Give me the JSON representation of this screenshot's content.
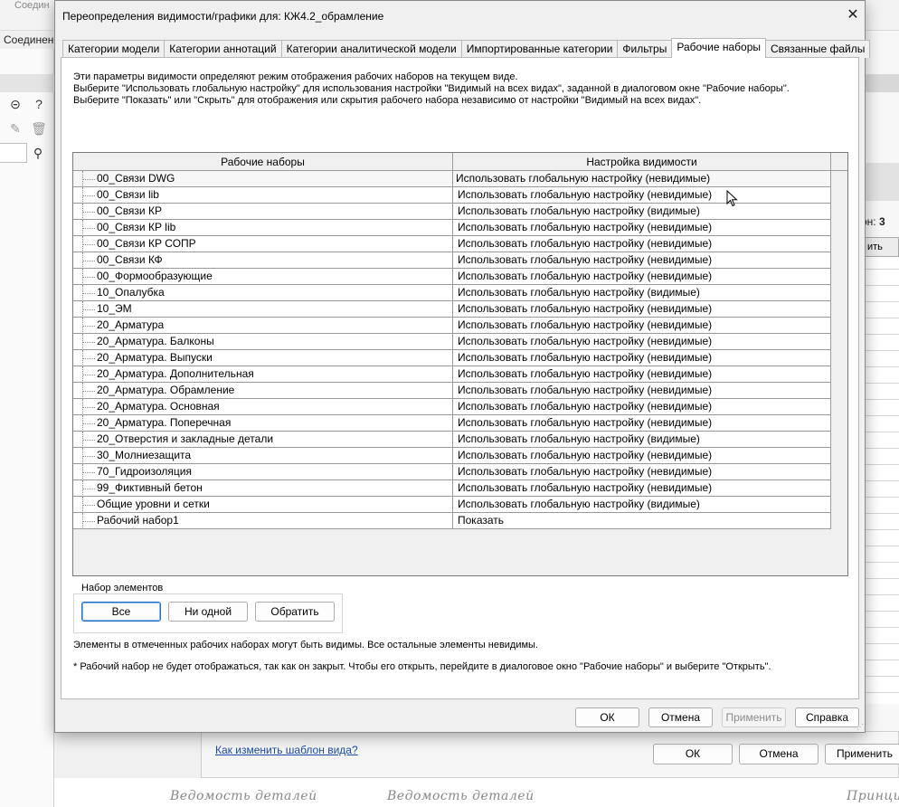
{
  "background": {
    "top_texts": [
      "Соедин",
      "Соединен"
    ],
    "left_label": "Соединени",
    "right_label_prefix": "он:",
    "right_label_value": "3",
    "right_cell": "ить",
    "lower_link": "Как изменить шаблон вида?",
    "lower_ok": "ОК",
    "lower_cancel": "Отмена",
    "lower_apply": "Применить",
    "bottom_texts": [
      "Ведомость деталей",
      "Ведомость деталей",
      "Принцип"
    ]
  },
  "dialog": {
    "title": "Переопределения видимости/графики для: КЖ4.2_обрамление",
    "close_icon": "close-icon",
    "tabs": [
      {
        "label": "Категории модели",
        "active": false
      },
      {
        "label": "Категории аннотаций",
        "active": false
      },
      {
        "label": "Категории аналитической модели",
        "active": false
      },
      {
        "label": "Импортированные категории",
        "active": false
      },
      {
        "label": "Фильтры",
        "active": false
      },
      {
        "label": "Рабочие наборы",
        "active": true
      },
      {
        "label": "Связанные файлы",
        "active": false
      }
    ],
    "description": [
      "Эти параметры видимости определяют режим отображения рабочих наборов на текущем виде.",
      "Выберите \"Использовать глобальную настройку\" для использования настройки \"Видимый на всех видах\", заданной в диалоговом окне \"Рабочие наборы\".",
      "Выберите \"Показать\" или \"Скрыть\" для отображения или скрытия рабочего набора независимо от настройки \"Видимый на всех видах\"."
    ],
    "table": {
      "columns": [
        "Рабочие наборы",
        "Настройка видимости"
      ],
      "rows": [
        [
          "00_Связи DWG",
          "Использовать глобальную настройку (невидимые)"
        ],
        [
          "00_Связи lib",
          "Использовать глобальную настройку (невидимые)"
        ],
        [
          "00_Связи КР",
          "Использовать глобальную настройку (видимые)"
        ],
        [
          "00_Связи КР lib",
          "Использовать глобальную настройку (невидимые)"
        ],
        [
          "00_Связи КР СОПР",
          "Использовать глобальную настройку (невидимые)"
        ],
        [
          "00_Связи КФ",
          "Использовать глобальную настройку (невидимые)"
        ],
        [
          "00_Формообразующие",
          "Использовать глобальную настройку (невидимые)"
        ],
        [
          "10_Опалубка",
          "Использовать глобальную настройку (видимые)"
        ],
        [
          "10_ЭМ",
          "Использовать глобальную настройку (невидимые)"
        ],
        [
          "20_Арматура",
          "Использовать глобальную настройку (невидимые)"
        ],
        [
          "20_Арматура. Балконы",
          "Использовать глобальную настройку (невидимые)"
        ],
        [
          "20_Арматура. Выпуски",
          "Использовать глобальную настройку (невидимые)"
        ],
        [
          "20_Арматура. Дополнительная",
          "Использовать глобальную настройку (невидимые)"
        ],
        [
          "20_Арматура. Обрамление",
          "Использовать глобальную настройку (невидимые)"
        ],
        [
          "20_Арматура. Основная",
          "Использовать глобальную настройку (невидимые)"
        ],
        [
          "20_Арматура. Поперечная",
          "Использовать глобальную настройку (невидимые)"
        ],
        [
          "20_Отверстия и закладные детали",
          "Использовать глобальную настройку (видимые)"
        ],
        [
          "30_Молниезащита",
          "Использовать глобальную настройку (невидимые)"
        ],
        [
          "70_Гидроизоляция",
          "Использовать глобальную настройку (невидимые)"
        ],
        [
          "99_Фиктивный бетон",
          "Использовать глобальную настройку (невидимые)"
        ],
        [
          "Общие уровни и сетки",
          "Использовать глобальную настройку (видимые)"
        ],
        [
          "Рабочий набор1",
          "Показать"
        ]
      ]
    },
    "selection_group": {
      "legend": "Набор элементов",
      "all": "Все",
      "none": "Ни одной",
      "invert": "Обратить"
    },
    "note1": "Элементы в отмеченных рабочих наборах могут быть видимы.  Все остальные элементы невидимы.",
    "note2": "* Рабочий набор не будет отображаться, так как он закрыт. Чтобы его открыть, перейдите в диалоговое окно \"Рабочие наборы\" и выберите \"Открыть\".",
    "buttons": {
      "ok": "ОК",
      "cancel": "Отмена",
      "apply": "Применить",
      "help": "Справка"
    }
  }
}
